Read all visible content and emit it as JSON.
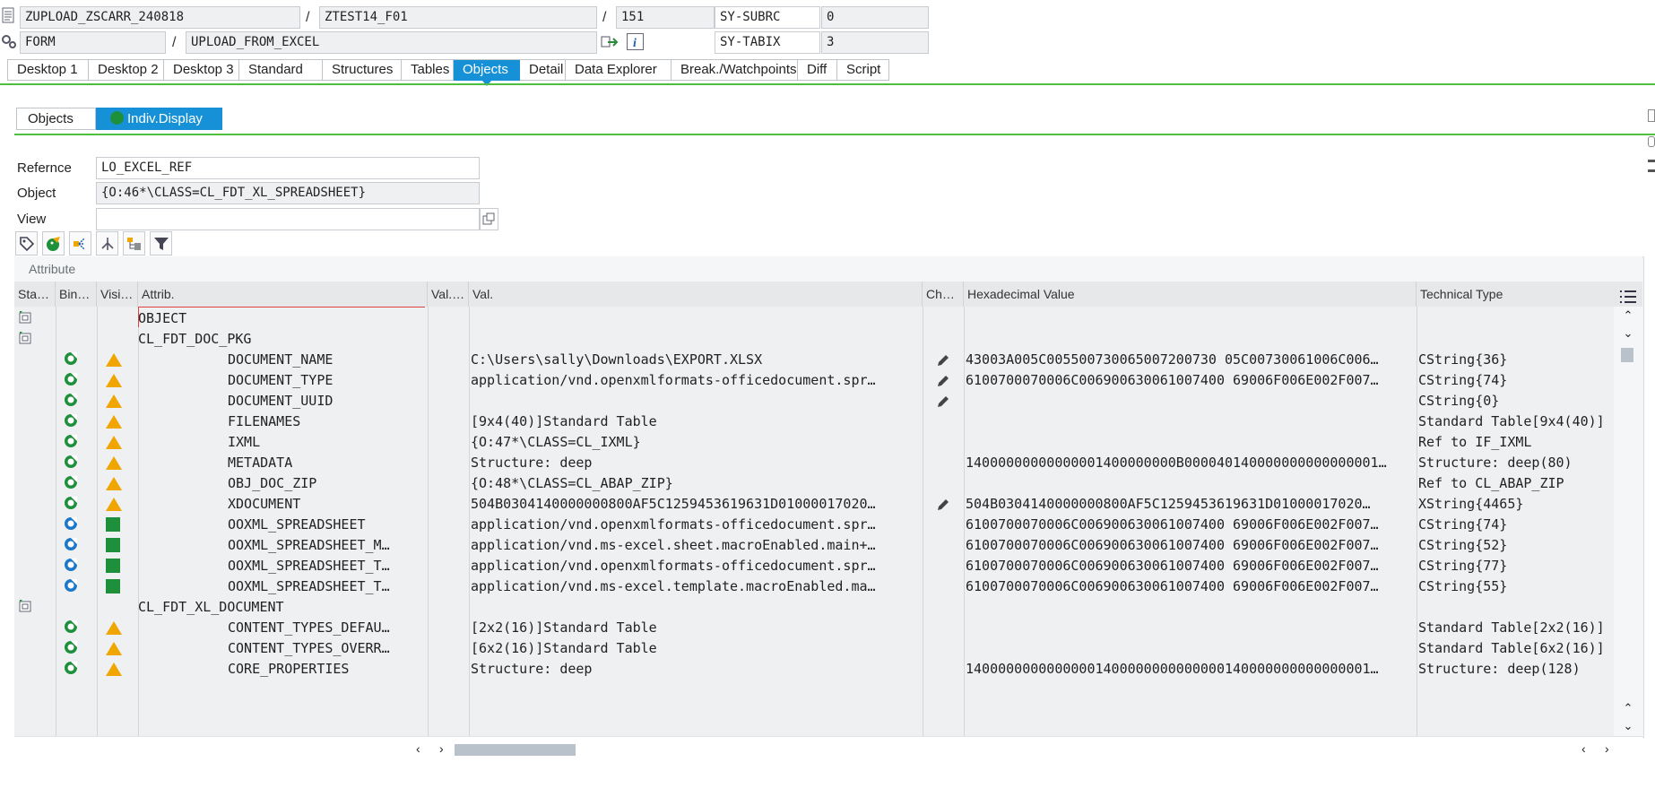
{
  "header": {
    "program": "ZUPLOAD_ZSCARR_240818",
    "include": "ZTEST14_F01",
    "line": "151",
    "sy_subrc_label": "SY-SUBRC",
    "sy_subrc_value": "0",
    "event_type": "FORM",
    "event_name": "UPLOAD_FROM_EXCEL",
    "sy_tabix_label": "SY-TABIX",
    "sy_tabix_value": "3",
    "sep": "/"
  },
  "tabs": [
    "Desktop 1",
    "Desktop 2",
    "Desktop 3",
    "Standard",
    "Structures",
    "Tables",
    "Objects",
    "Detail",
    "Data Explorer",
    "Break./Watchpoints",
    "Diff",
    "Script"
  ],
  "active_tab": "Objects",
  "subtabs": {
    "objects": "Objects",
    "indiv": "Indiv.Display"
  },
  "form": {
    "reference_label": "Refernce",
    "reference_value": "LO_EXCEL_REF",
    "object_label": "Object",
    "object_value": "{O:46*\\CLASS=CL_FDT_XL_SPREADSHEET}",
    "view_label": "View",
    "view_value": ""
  },
  "toolbar_icons": [
    "tag-icon",
    "parrot-icon",
    "hierarchy-icon",
    "split-icon",
    "tree-icon",
    "filter-icon"
  ],
  "grid": {
    "title": "Attribute",
    "columns": {
      "status": "Sta…",
      "binding": "Bin…",
      "visibility": "Visi…",
      "attrib": "Attrib.",
      "valtype": "Val.…",
      "val": "Val.",
      "change": "Ch…",
      "hex": "Hexadecimal Value",
      "techtype": "Technical Type"
    },
    "rows": [
      {
        "kind": "class",
        "attrib": "OBJECT",
        "val": "",
        "hex": "",
        "tech": "",
        "edit": false,
        "vis": ""
      },
      {
        "kind": "class",
        "attrib": "CL_FDT_DOC_PKG",
        "val": "",
        "hex": "",
        "tech": "",
        "edit": false,
        "vis": ""
      },
      {
        "kind": "attr",
        "bin": "inst",
        "vis": "warn",
        "attrib": "DOCUMENT_NAME",
        "val": "C:\\Users\\sally\\Downloads\\EXPORT.XLSX",
        "hex": "43003A005C005500730065007200730 05C00730061006C006…",
        "tech": "CString{36}",
        "edit": true
      },
      {
        "kind": "attr",
        "bin": "inst",
        "vis": "warn",
        "attrib": "DOCUMENT_TYPE",
        "val": "application/vnd.openxmlformats-officedocument.spr…",
        "hex": "6100700070006C006900630061007400 69006F006E002F007…",
        "tech": "CString{74}",
        "edit": true
      },
      {
        "kind": "attr",
        "bin": "inst",
        "vis": "warn",
        "attrib": "DOCUMENT_UUID",
        "val": "",
        "hex": "",
        "tech": "CString{0}",
        "edit": true
      },
      {
        "kind": "attr",
        "bin": "inst",
        "vis": "warn",
        "attrib": "FILENAMES",
        "val": "[9x4(40)]Standard Table",
        "hex": "",
        "tech": "Standard Table[9x4(40)]",
        "edit": false
      },
      {
        "kind": "attr",
        "bin": "inst",
        "vis": "warn",
        "attrib": "IXML",
        "val": "{O:47*\\CLASS=CL_IXML}",
        "hex": "",
        "tech": "Ref to IF_IXML",
        "edit": false
      },
      {
        "kind": "attr",
        "bin": "inst",
        "vis": "warn",
        "attrib": "METADATA",
        "val": "Structure: deep",
        "hex": "14000000000000001400000000B000040140000000000000001…",
        "tech": "Structure: deep(80)",
        "edit": false
      },
      {
        "kind": "attr",
        "bin": "inst",
        "vis": "warn",
        "attrib": "OBJ_DOC_ZIP",
        "val": "{O:48*\\CLASS=CL_ABAP_ZIP}",
        "hex": "",
        "tech": "Ref to CL_ABAP_ZIP",
        "edit": false
      },
      {
        "kind": "attr",
        "bin": "inst",
        "vis": "warn",
        "attrib": "XDOCUMENT",
        "val": "504B0304140000000800AF5C1259453619631D01000017020…",
        "hex": "504B0304140000000800AF5C1259453619631D01000017020…",
        "tech": "XString{4465}",
        "edit": true
      },
      {
        "kind": "attr",
        "bin": "static",
        "vis": "pub",
        "attrib": "OOXML_SPREADSHEET",
        "val": "application/vnd.openxmlformats-officedocument.spr…",
        "hex": "6100700070006C006900630061007400 69006F006E002F007…",
        "tech": "CString{74}",
        "edit": false
      },
      {
        "kind": "attr",
        "bin": "static",
        "vis": "pub",
        "attrib": "OOXML_SPREADSHEET_M…",
        "val": "application/vnd.ms-excel.sheet.macroEnabled.main+…",
        "hex": "6100700070006C006900630061007400 69006F006E002F007…",
        "tech": "CString{52}",
        "edit": false
      },
      {
        "kind": "attr",
        "bin": "static",
        "vis": "pub",
        "attrib": "OOXML_SPREADSHEET_T…",
        "val": "application/vnd.openxmlformats-officedocument.spr…",
        "hex": "6100700070006C006900630061007400 69006F006E002F007…",
        "tech": "CString{77}",
        "edit": false
      },
      {
        "kind": "attr",
        "bin": "static",
        "vis": "pub",
        "attrib": "OOXML_SPREADSHEET_T…",
        "val": "application/vnd.ms-excel.template.macroEnabled.ma…",
        "hex": "6100700070006C006900630061007400 69006F006E002F007…",
        "tech": "CString{55}",
        "edit": false
      },
      {
        "kind": "class",
        "attrib": "CL_FDT_XL_DOCUMENT",
        "val": "",
        "hex": "",
        "tech": "",
        "edit": false,
        "vis": ""
      },
      {
        "kind": "attr",
        "bin": "inst",
        "vis": "warn",
        "attrib": "CONTENT_TYPES_DEFAU…",
        "val": "[2x2(16)]Standard Table",
        "hex": "",
        "tech": "Standard Table[2x2(16)]",
        "edit": false
      },
      {
        "kind": "attr",
        "bin": "inst",
        "vis": "warn",
        "attrib": "CONTENT_TYPES_OVERR…",
        "val": "[6x2(16)]Standard Table",
        "hex": "",
        "tech": "Standard Table[6x2(16)]",
        "edit": false
      },
      {
        "kind": "attr",
        "bin": "inst",
        "vis": "warn",
        "attrib": "CORE_PROPERTIES",
        "val": "Structure: deep",
        "hex": "14000000000000001400000000000000140000000000000001…",
        "tech": "Structure: deep(128)",
        "edit": false
      }
    ]
  },
  "colors": {
    "accent": "#1691d8",
    "green_line": "#4fbf3f",
    "warn": "#f0a500",
    "public": "#1e8f3a"
  }
}
